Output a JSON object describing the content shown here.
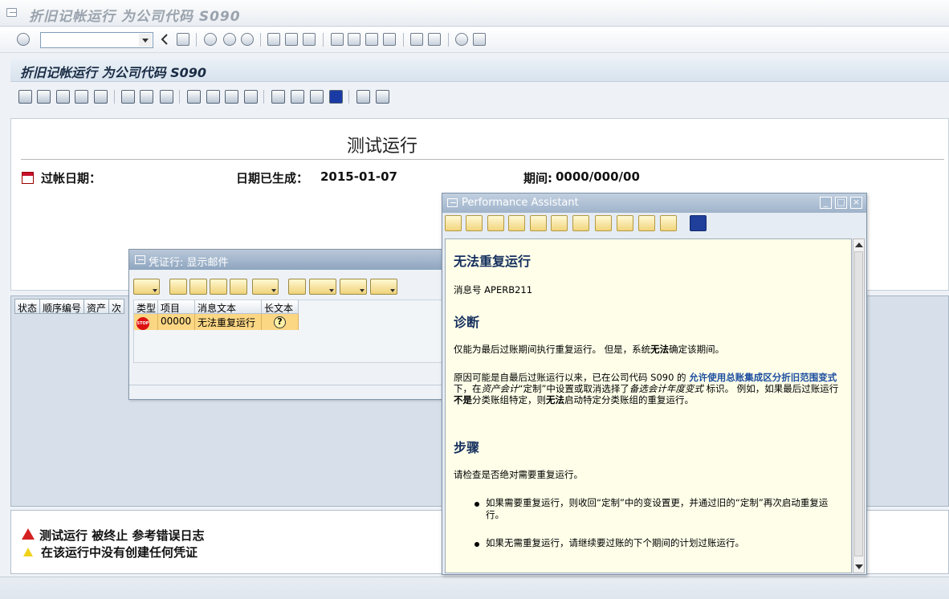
{
  "window": {
    "title": "折旧记帐运行 为公司代码 S090"
  },
  "screen": {
    "title": "折旧记帐运行 为公司代码 S090"
  },
  "report": {
    "run_title": "测试运行",
    "posting_date_label": "过帐日期：",
    "date_generated_label": "日期已生成：",
    "date_generated_value": "2015-01-07",
    "period_label": "期间:",
    "period_value": "0000/000/00"
  },
  "grid": {
    "columns": [
      "状态",
      "顺序编号",
      "资产",
      "次"
    ]
  },
  "messages": {
    "line1": "测试运行  被终止  参考错误日志",
    "line2": "在该运行中没有创建任何凭证"
  },
  "dialog": {
    "title": "凭证行: 显示邮件",
    "columns": [
      "类型",
      "项目",
      "消息文本",
      "长文本"
    ],
    "row": {
      "type_icon": "stop-icon",
      "item": "00000",
      "text": "无法重复运行",
      "longtext_icon": "help-icon"
    },
    "stop_label": "STOP"
  },
  "assistant": {
    "title": "Performance Assistant",
    "heading": "无法重复运行",
    "msg_no": "消息号  APERB211",
    "diagnosis_heading": "诊断",
    "diagnosis_a": "仅能为最后过账期间执行重复运行。  但是，系统",
    "diagnosis_b": "无法",
    "diagnosis_c": "确定该期间。",
    "cause_1": "原因可能是自最后过账运行以来，已在公司代码  S090 的  ",
    "cause_link": "允许使用总账集成区分折旧范围变式",
    "cause_2": "下，在",
    "cause_it1": "资产会计",
    "cause_3": "“定制”中设置或取消选择了",
    "cause_it2": "备选会计年度变式",
    "cause_4": " 标识。  例如，如果最后过账运行",
    "cause_b1": "不是",
    "cause_5": "分类账组特定，则",
    "cause_b2": "无法",
    "cause_6": "启动特定分类账组的重复运行。",
    "steps_heading": "步骤",
    "steps_intro": "请检查是否绝对需要重复运行。",
    "bullet1": "如果需要重复运行，则收回“定制”中的变设置更，并通过旧的“定制”再次启动重复运行。",
    "bullet2": "如果无需重复运行，请继续要过账的下个期间的计划过账运行。"
  },
  "colors": {
    "accent": "#16305e",
    "highlight_row": "#fbd784",
    "help_bg": "#fefee9"
  }
}
